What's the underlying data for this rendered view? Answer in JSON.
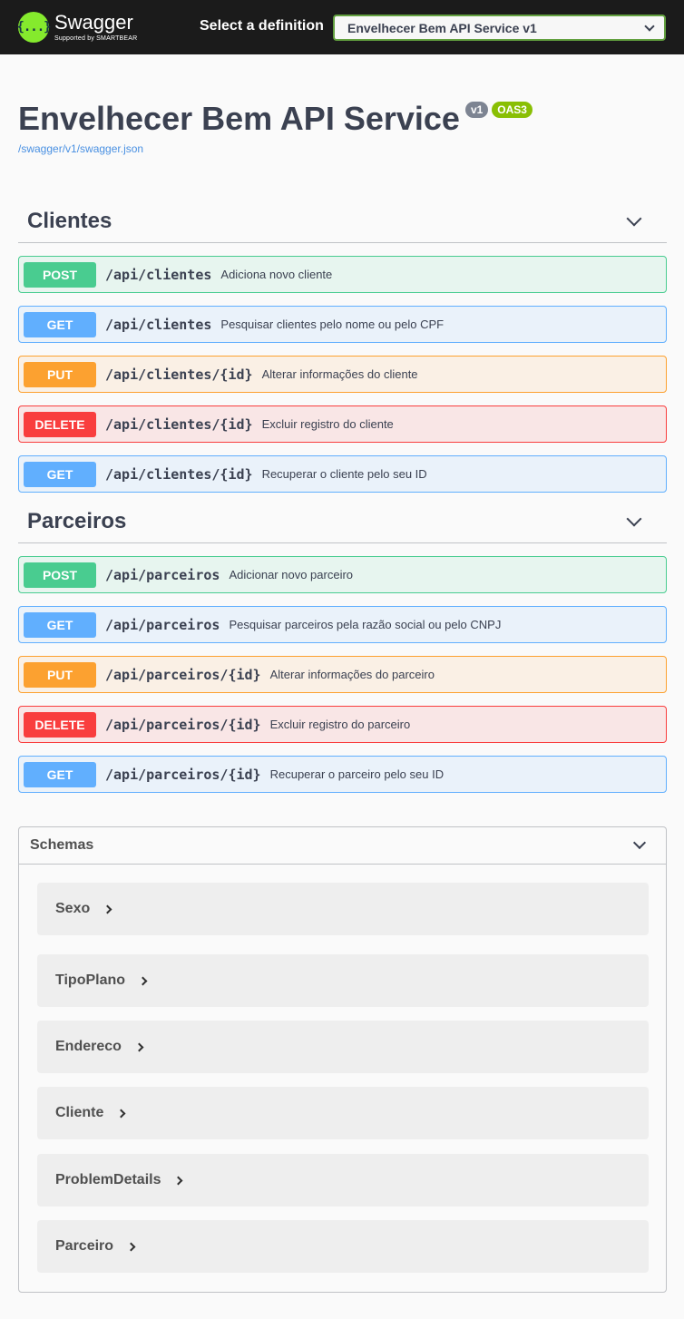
{
  "topbar": {
    "brand_name": "Swagger",
    "brand_sub": "Supported by SMARTBEAR",
    "logo_glyph": "{...}",
    "definition_label": "Select a definition",
    "definition_value": "Envelhecer Bem API Service v1"
  },
  "info": {
    "title": "Envelhecer Bem API Service",
    "version_badge": "v1",
    "oas_badge": "OAS3",
    "spec_url": "/swagger/v1/swagger.json"
  },
  "tags": [
    {
      "name": "Clientes",
      "operations": [
        {
          "method": "POST",
          "path": "/api/clientes",
          "summary": "Adiciona novo cliente"
        },
        {
          "method": "GET",
          "path": "/api/clientes",
          "summary": "Pesquisar clientes pelo nome ou pelo CPF"
        },
        {
          "method": "PUT",
          "path": "/api/clientes/{id}",
          "summary": "Alterar informações do cliente"
        },
        {
          "method": "DELETE",
          "path": "/api/clientes/{id}",
          "summary": "Excluir registro do cliente"
        },
        {
          "method": "GET",
          "path": "/api/clientes/{id}",
          "summary": "Recuperar o cliente pelo seu ID"
        }
      ]
    },
    {
      "name": "Parceiros",
      "operations": [
        {
          "method": "POST",
          "path": "/api/parceiros",
          "summary": "Adicionar novo parceiro"
        },
        {
          "method": "GET",
          "path": "/api/parceiros",
          "summary": "Pesquisar parceiros pela razão social ou pelo CNPJ"
        },
        {
          "method": "PUT",
          "path": "/api/parceiros/{id}",
          "summary": "Alterar informações do parceiro"
        },
        {
          "method": "DELETE",
          "path": "/api/parceiros/{id}",
          "summary": "Excluir registro do parceiro"
        },
        {
          "method": "GET",
          "path": "/api/parceiros/{id}",
          "summary": "Recuperar o parceiro pelo seu ID"
        }
      ]
    }
  ],
  "schemas": {
    "title": "Schemas",
    "models": [
      "Sexo",
      "TipoPlano",
      "Endereco",
      "Cliente",
      "ProblemDetails",
      "Parceiro"
    ]
  },
  "colors": {
    "topbar_bg": "#1b1b1b",
    "post": "#49cc90",
    "get": "#61affe",
    "put": "#fca130",
    "delete": "#f93e3e",
    "brand_green": "#85ea2d"
  }
}
